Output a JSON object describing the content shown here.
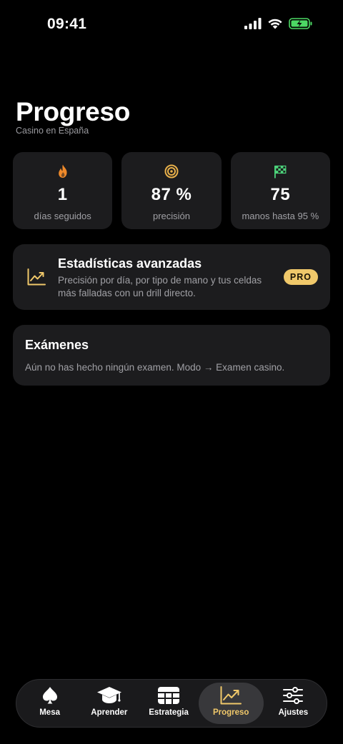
{
  "status_bar": {
    "time": "09:41"
  },
  "header": {
    "title": "Progreso",
    "subtitle": "Casino en España"
  },
  "stats": [
    {
      "icon": "flame-icon",
      "value": "1",
      "label": "días seguidos"
    },
    {
      "icon": "target-icon",
      "value": "87 %",
      "label": "precisión"
    },
    {
      "icon": "checkered-flag-icon",
      "value": "75",
      "label": "manos hasta 95 %"
    }
  ],
  "advanced": {
    "icon": "trend-chart-icon",
    "title": "Estadísticas avanzadas",
    "description": "Precisión por día, por tipo de mano y tus celdas más falladas con un drill directo.",
    "badge": "PRO"
  },
  "exams": {
    "title": "Exámenes",
    "text": "Aún no has hecho ningún examen. Modo → Examen casino."
  },
  "tabs": [
    {
      "icon": "spade-icon",
      "label": "Mesa",
      "active": false
    },
    {
      "icon": "graduation-cap-icon",
      "label": "Aprender",
      "active": false
    },
    {
      "icon": "table-grid-icon",
      "label": "Estrategia",
      "active": false
    },
    {
      "icon": "trend-chart-icon",
      "label": "Progreso",
      "active": true
    },
    {
      "icon": "sliders-icon",
      "label": "Ajustes",
      "active": false
    }
  ],
  "colors": {
    "accent": "#f0c86a",
    "card": "#1c1c1e",
    "flame": "#f08a2a",
    "target": "#e8b04a",
    "flag": "#4cd27a",
    "battery": "#4cd964"
  }
}
